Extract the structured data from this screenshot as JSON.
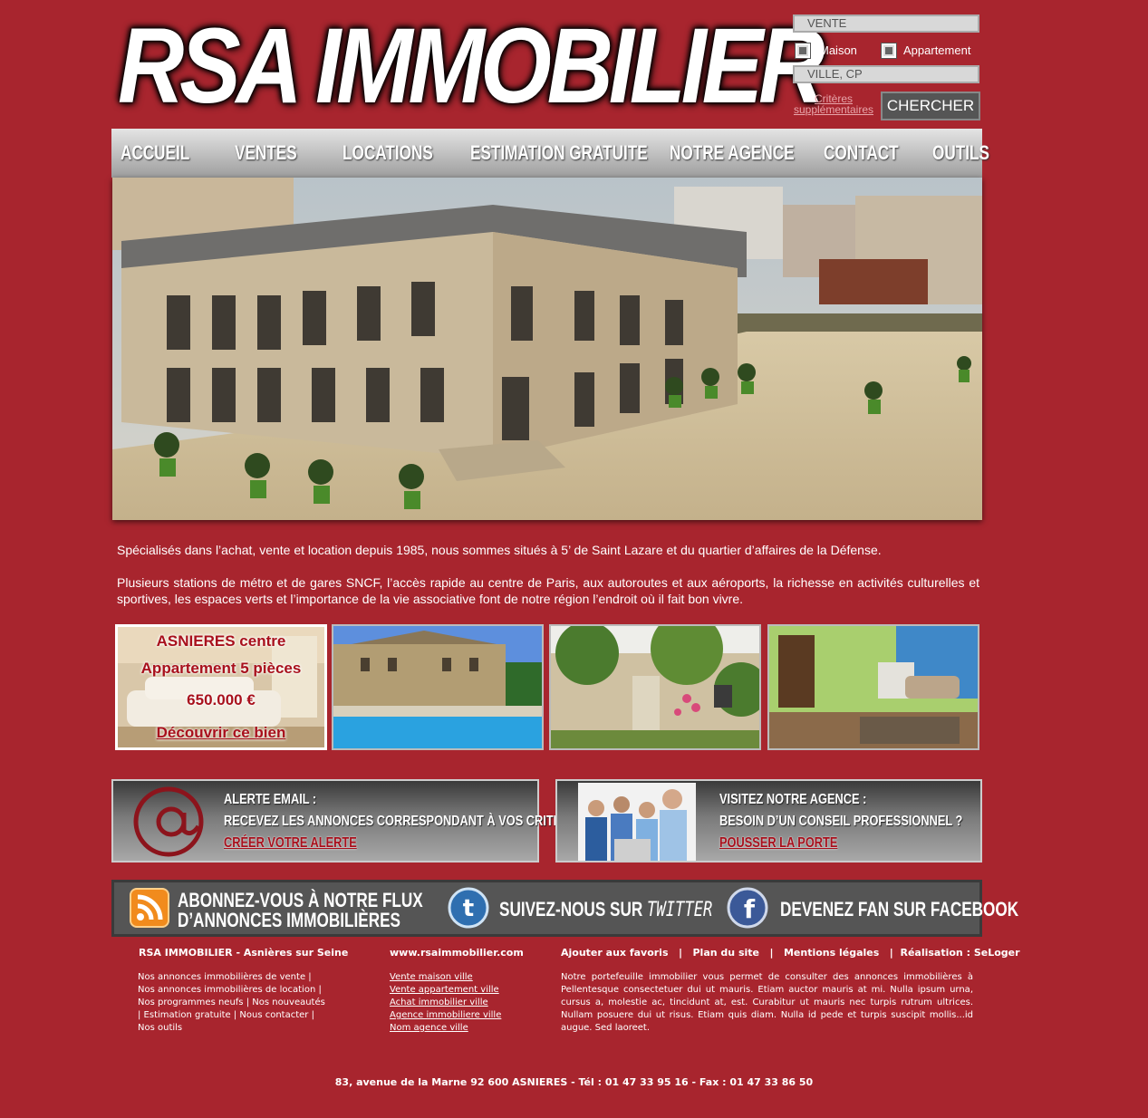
{
  "brand": {
    "logo_text": "RSA IMMOBILIER"
  },
  "search": {
    "transaction": "VENTE",
    "types": [
      {
        "label": "Maison"
      },
      {
        "label": "Appartement"
      }
    ],
    "city_placeholder": "VILLE, CP",
    "criteria_line1": "Critères",
    "criteria_line2": "supplémentaires",
    "submit_label": "CHERCHER"
  },
  "nav": {
    "items": [
      {
        "label": "ACCUEIL"
      },
      {
        "label": "VENTES"
      },
      {
        "label": "LOCATIONS"
      },
      {
        "label": "ESTIMATION  GRATUITE"
      },
      {
        "label": "NOTRE AGENCE"
      },
      {
        "label": "CONTACT"
      },
      {
        "label": "OUTILS"
      }
    ]
  },
  "intro": {
    "p1": "Spécialisés dans l’achat, vente et location depuis 1985, nous sommes situés à 5’ de Saint Lazare et du quartier d’affaires de la Défense.",
    "p2": "Plusieurs stations de métro et de gares SNCF, l’accès rapide au centre de Paris, aux autoroutes et aux aéroports, la richesse en activités culturelles et sportives, les espaces verts et l’importance de la vie associative font de notre région l’endroit où il fait bon vivre."
  },
  "featured": {
    "title": "ASNIERES centre",
    "subtitle": "Appartement 5 pièces",
    "price": "650.000 €",
    "cta": "Découvrir ce bien"
  },
  "alert_banner": {
    "line1": "ALERTE EMAIL :",
    "line2": "RECEVEZ LES ANNONCES CORRESPONDANT À VOS CRITÈRES",
    "link": "CRÉER VOTRE ALERTE"
  },
  "agency_banner": {
    "line1": "VISITEZ NOTRE AGENCE :",
    "line2": "BESOIN D’UN CONSEIL PROFESSIONNEL ?",
    "link": "POUSSER LA PORTE"
  },
  "social": {
    "rss_line1": "ABONNEZ-VOUS À NOTRE FLUX",
    "rss_line2": "D’ANNONCES IMMOBILIÈRES",
    "twitter_prefix": "SUIVEZ-NOUS SUR",
    "twitter_word": "TWITTER",
    "facebook": "DEVENEZ FAN SUR FACEBOOK"
  },
  "footer": {
    "col1_title": "RSA IMMOBILIER - Asnières sur Seine",
    "col1_lines": [
      "Nos annonces immobilières de vente |",
      "Nos annonces immobilières de location |",
      "Nos programmes neufs | Nos nouveautés",
      "| Estimation gratuite | Nous contacter |",
      "Nos outils"
    ],
    "col2_title": "www.rsaimmobilier.com",
    "col2_links": [
      "Vente maison ville",
      "Vente appartement ville",
      "Achat immobilier ville",
      "Agence immobiliere ville",
      "Nom agence ville"
    ],
    "col3_title": "Ajouter aux favoris   |   Plan du site   |   Mentions légales   |  Réalisation : SeLoger",
    "col3_text": "Notre portefeuille immobilier vous permet de consulter des annonces immobilières à Pellentesque consectetuer dui ut mauris. Etiam auctor mauris at mi. Nulla ipsum urna, cursus a, molestie ac, tincidunt at, est. Curabitur ut mauris nec turpis rutrum ultrices. Nullam posuere dui ut risus. Etiam quis diam. Nulla id pede et turpis suscipit mollis...id augue. Sed laoreet.",
    "address": "83, avenue de la Marne 92 600 ASNIERES - Tél : 01 47 33 95 16 - Fax : 01 47 33 86 50"
  },
  "colors": {
    "background": "#a8252e",
    "accent_red": "#a8101c",
    "nav_gradient_top": "#e4e4e4",
    "nav_gradient_bottom": "#9e9e9e"
  }
}
